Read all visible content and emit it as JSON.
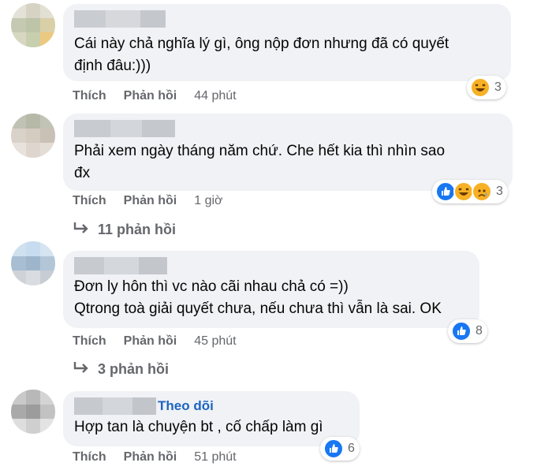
{
  "comments": [
    {
      "text": "Cái này chả nghĩa lý gì, ông nộp đơn nhưng đã có quyết\nđịnh đâu:)))",
      "like": "Thích",
      "reply": "Phản hồi",
      "time": "44 phút",
      "reactions": [
        "haha"
      ],
      "reaction_count": "3"
    },
    {
      "text": "Phải xem ngày tháng năm chứ. Che hết kia thì nhìn sao\nđx",
      "like": "Thích",
      "reply": "Phản hồi",
      "time": "1 giờ",
      "reactions": [
        "like",
        "haha",
        "sad"
      ],
      "reaction_count": "3",
      "replies_label": "11 phản hồi"
    },
    {
      "text": "Đơn ly hôn thì vc nào cãi nhau chả có =))\nQtrong toà giải quyết chưa, nếu chưa thì vẫn là sai. OK",
      "like": "Thích",
      "reply": "Phản hồi",
      "time": "45 phút",
      "reactions": [
        "like"
      ],
      "reaction_count": "8",
      "replies_label": "3 phản hồi"
    },
    {
      "follow": "Theo dõi",
      "text": "Hợp tan là chuyện bt , cố chấp làm gì",
      "like": "Thích",
      "reply": "Phản hồi",
      "time": "51 phút",
      "reactions": [
        "like"
      ],
      "reaction_count": "6"
    }
  ],
  "colors": {
    "bubble": "#f0f2f5",
    "secondary_text": "#65676b",
    "link": "#1d65c1",
    "like_blue": "#1877f2",
    "emoji_yellow": "#f7b125"
  }
}
